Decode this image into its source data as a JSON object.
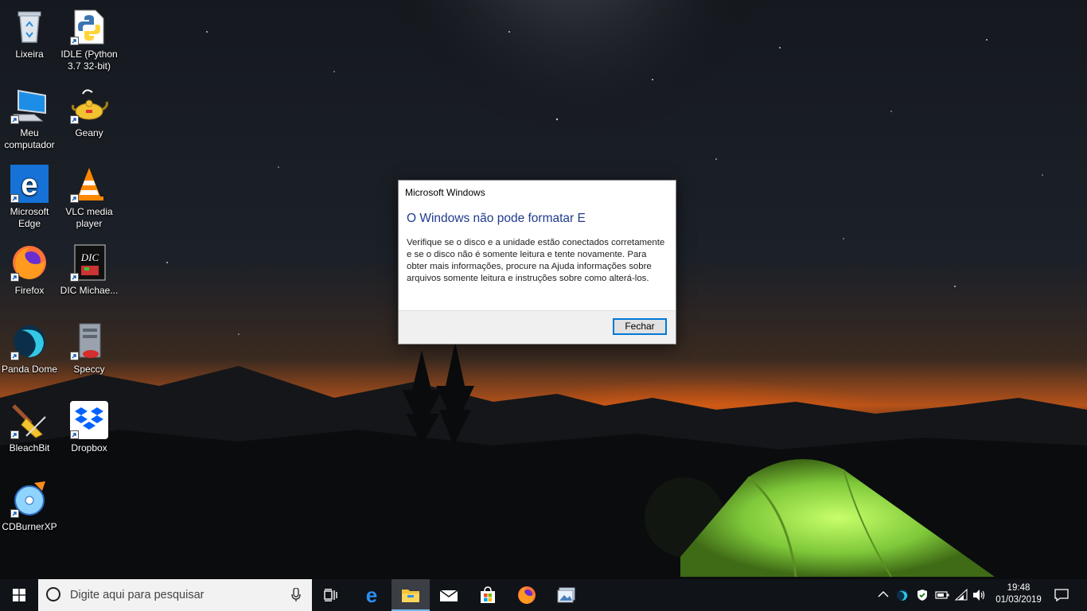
{
  "desktop": {
    "icons": [
      {
        "id": "recycle-bin",
        "label": "Lixeira"
      },
      {
        "id": "idle-python",
        "label": "IDLE (Python 3.7 32-bit)"
      },
      {
        "id": "my-computer",
        "label": "Meu computador"
      },
      {
        "id": "geany",
        "label": "Geany"
      },
      {
        "id": "microsoft-edge",
        "label": "Microsoft Edge"
      },
      {
        "id": "vlc",
        "label": "VLC media player"
      },
      {
        "id": "firefox",
        "label": "Firefox"
      },
      {
        "id": "dic",
        "label": "DIC Michae..."
      },
      {
        "id": "panda-dome",
        "label": "Panda Dome"
      },
      {
        "id": "speccy",
        "label": "Speccy"
      },
      {
        "id": "bleachbit",
        "label": "BleachBit"
      },
      {
        "id": "dropbox",
        "label": "Dropbox"
      },
      {
        "id": "cdburnerxp",
        "label": "CDBurnerXP"
      }
    ]
  },
  "dialog": {
    "title": "Microsoft Windows",
    "heading": "O Windows não pode formatar E",
    "message": "Verifique se o disco e a unidade estão conectados corretamente e se o disco não é somente leitura e tente novamente. Para obter mais informações, procure na Ajuda informações sobre arquivos somente leitura e instruções sobre como alterá-los.",
    "close_label": "Fechar"
  },
  "taskbar": {
    "search_placeholder": "Digite aqui para pesquisar",
    "pinned": [
      "start-icon",
      "task-view-icon",
      "edge-icon",
      "file-explorer-icon",
      "mail-icon",
      "store-icon",
      "firefox-icon",
      "photos-icon"
    ],
    "active_app": "file-explorer-icon",
    "tray_icons": [
      "chevron-up-icon",
      "panda-tray-icon",
      "defender-icon",
      "battery-icon",
      "wifi-icon",
      "volume-icon"
    ],
    "clock": {
      "time": "19:48",
      "date": "01/03/2019"
    }
  },
  "colors": {
    "dialog_heading": "#1f3b8c",
    "button_border": "#0078d7",
    "taskbar_bg": "#101318",
    "tent_green": "#7ec83a"
  }
}
